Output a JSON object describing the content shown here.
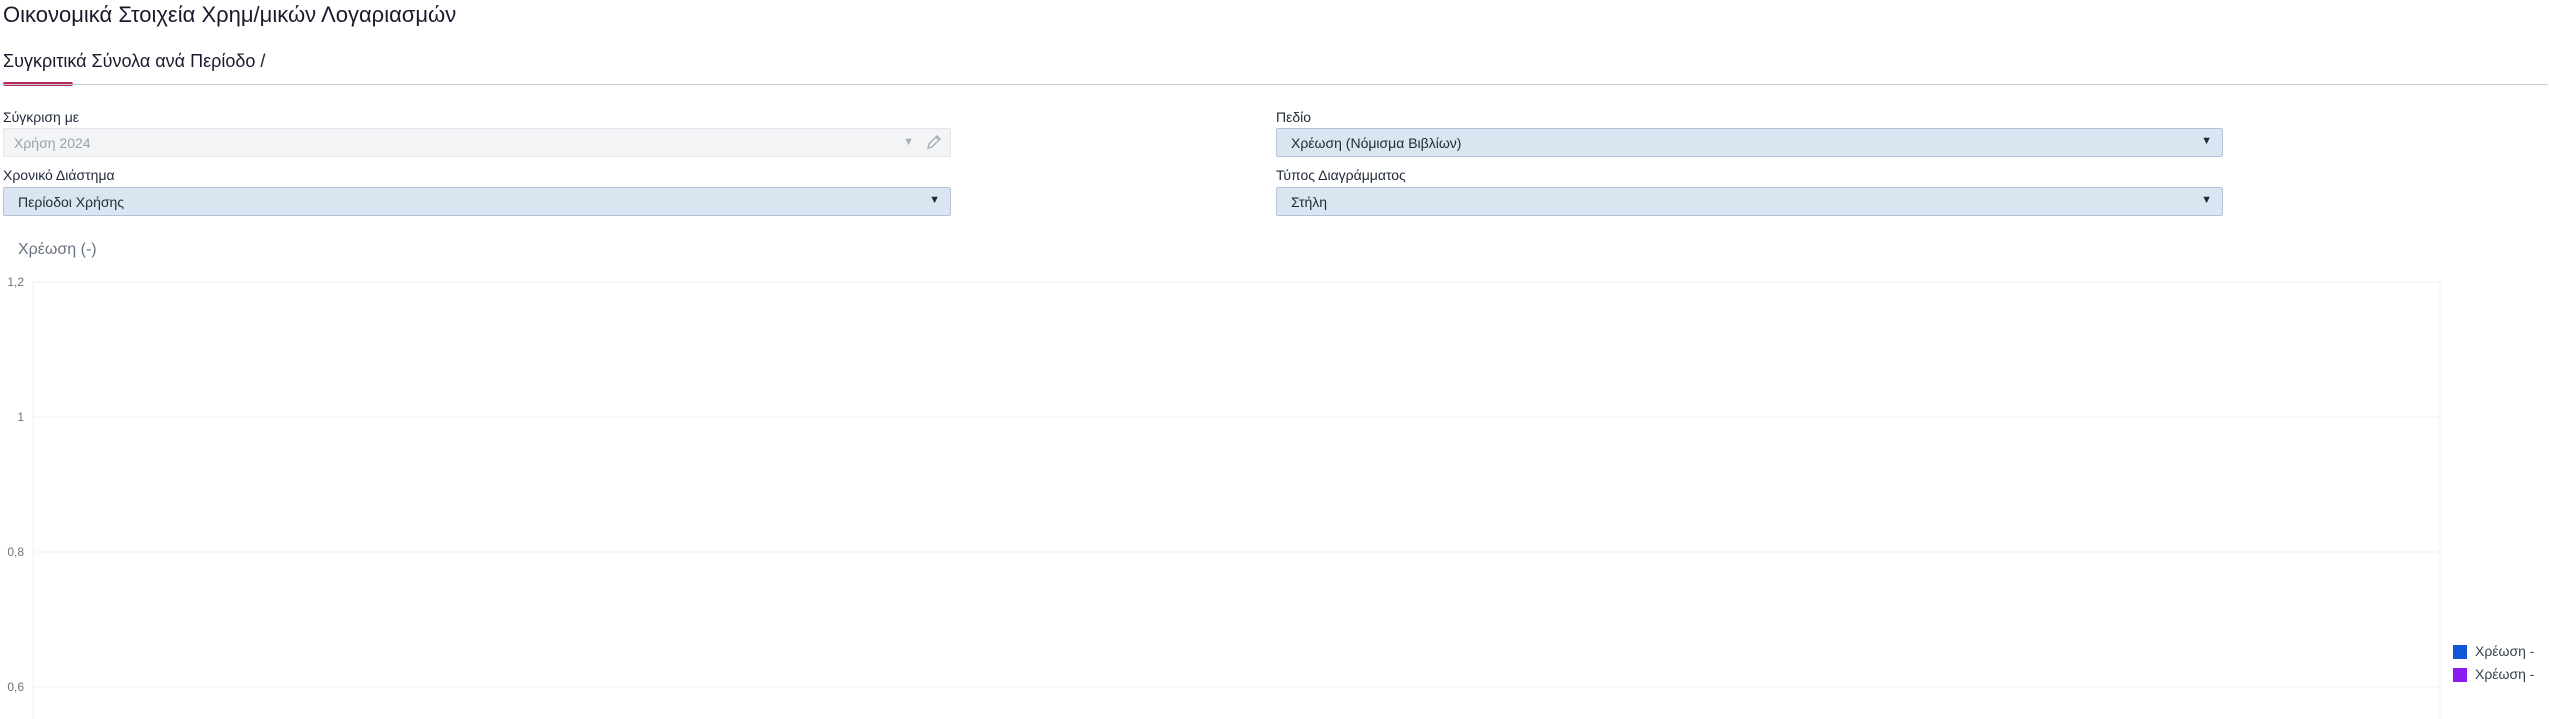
{
  "page": {
    "title": "Οικονομικά Στοιχεία Χρημ/μικών Λογαριασμών",
    "tab_label": "Συγκριτικά Σύνολα ανά Περίοδο /"
  },
  "filters": {
    "compare_with": {
      "label": "Σύγκριση με",
      "value": "Χρήση 2024",
      "disabled": true
    },
    "field": {
      "label": "Πεδίο",
      "value": "Χρέωση (Νόμισμα Βιβλίων)"
    },
    "period": {
      "label": "Χρονικό Διάστημα",
      "value": "Περίοδοι Χρήσης"
    },
    "chart_type": {
      "label": "Τύπος Διαγράμματος",
      "value": "Στήλη"
    }
  },
  "icons": {
    "caret": "chevron-down-icon",
    "edit": "pencil-icon"
  },
  "colors": {
    "accent": "#b5285e",
    "series_1": "#1256d8",
    "series_2": "#8a1cf2"
  },
  "chart_data": {
    "type": "bar",
    "title": "Χρέωση (-)",
    "y_ticks": [
      "1,2",
      "1",
      "0,8",
      "0,6"
    ],
    "ylim_visible": [
      0.6,
      1.2
    ],
    "grid": true,
    "legend_position": "right",
    "series": [
      {
        "name": "Χρέωση -",
        "color": "#1256d8",
        "values": []
      },
      {
        "name": "Χρέωση -",
        "color": "#8a1cf2",
        "values": []
      }
    ]
  }
}
